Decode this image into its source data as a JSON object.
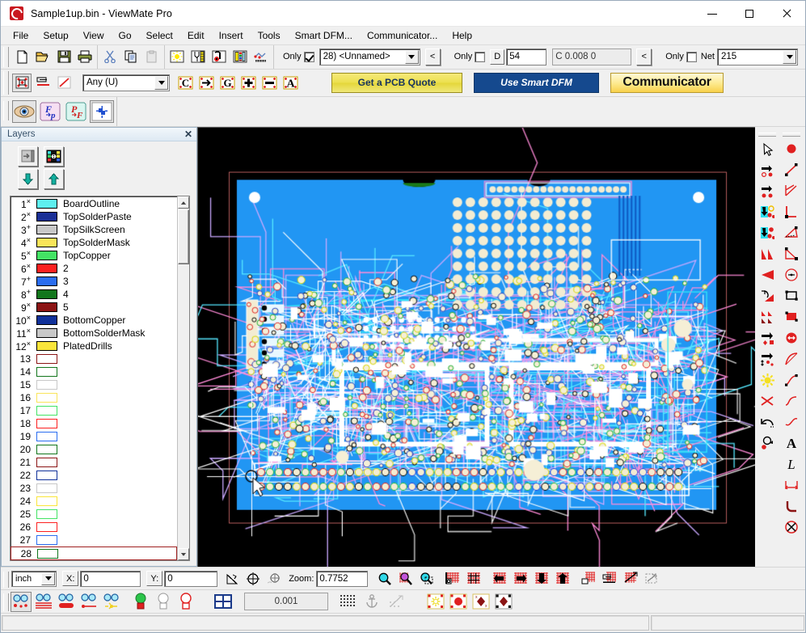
{
  "window": {
    "title": "Sample1up.bin - ViewMate Pro",
    "icon": "viewmate-logo-icon",
    "buttons": {
      "minimize": "minimize",
      "maximize": "maximize",
      "close": "close"
    }
  },
  "menu": {
    "items": [
      {
        "label": "File"
      },
      {
        "label": "Setup"
      },
      {
        "label": "View"
      },
      {
        "label": "Go"
      },
      {
        "label": "Select"
      },
      {
        "label": "Edit"
      },
      {
        "label": "Insert"
      },
      {
        "label": "Tools"
      },
      {
        "label": "Smart DFM..."
      },
      {
        "label": "Communicator..."
      },
      {
        "label": "Help"
      }
    ]
  },
  "toolbar_file": {
    "icons": [
      "new-document-icon",
      "open-folder-icon",
      "save-disk-icon",
      "print-icon"
    ]
  },
  "toolbar_clipboard": {
    "icons": [
      "cut-scissors-icon",
      "copy-icon",
      "paste-icon"
    ]
  },
  "toolbar_display": {
    "icons": [
      "flash-display-icon",
      "aperture-icon",
      "drill-icon",
      "layers-color-icon",
      "trace-icon"
    ]
  },
  "layer_selector": {
    "only_label": "Only",
    "only_checked": true,
    "value": "28) <Unnamed>",
    "prev_button": "<"
  },
  "dcode_selector": {
    "only_label": "Only",
    "only_checked": false,
    "d_label": "D",
    "d_value": "54",
    "c_value": "C 0.008  0",
    "prev_button": "<"
  },
  "net_selector": {
    "only_label": "Only",
    "only_checked": false,
    "net_label": "Net",
    "value": "215"
  },
  "toolbar_edit2": {
    "icons": [
      "select-pads-icon",
      "select-traces-icon",
      "draw-line-icon"
    ],
    "type_combo_value": "Any   (U)",
    "letter_icons": [
      "copper-c-icon",
      "goto-arrow-icon",
      "graphic-g-icon",
      "plus-pad-icon",
      "minus-pad-icon",
      "text-a-icon"
    ]
  },
  "toolbar_view2": {
    "icons": [
      "eye-visibility-icon",
      "flash-to-pad-icon",
      "pad-to-flash-icon",
      "add-net-icon"
    ]
  },
  "promo": {
    "quote_label": "Get a PCB Quote",
    "dfm_label": "Use Smart DFM",
    "communicator_label": "Communicator"
  },
  "layers_panel": {
    "title": "Layers",
    "close_icon": "close-icon",
    "tools": [
      "align-layers-icon",
      "layer-colors-icon",
      "move-down-icon",
      "move-up-icon"
    ],
    "rows": [
      {
        "num": "1",
        "sup": "×",
        "color": "#5ef0f0",
        "name": "BoardOutline",
        "filled": true
      },
      {
        "num": "2",
        "sup": "×",
        "color": "#1a2f96",
        "name": "TopSolderPaste",
        "filled": true
      },
      {
        "num": "3",
        "sup": "+",
        "color": "#c8c8c8",
        "name": "TopSilkScreen",
        "filled": true
      },
      {
        "num": "4",
        "sup": "×",
        "color": "#fae55a",
        "name": "TopSolderMask",
        "filled": true
      },
      {
        "num": "5",
        "sup": "×",
        "color": "#43e364",
        "name": "TopCopper",
        "filled": true
      },
      {
        "num": "6",
        "sup": "×",
        "color": "#fc2020",
        "name": "2",
        "filled": true
      },
      {
        "num": "7",
        "sup": "+",
        "color": "#2a6df0",
        "name": "3",
        "filled": true
      },
      {
        "num": "8",
        "sup": "+",
        "color": "#12761c",
        "name": "4",
        "filled": true
      },
      {
        "num": "9",
        "sup": "×",
        "color": "#8b1414",
        "name": "5",
        "filled": true
      },
      {
        "num": "10",
        "sup": "×",
        "color": "#10319a",
        "name": "BottomCopper",
        "filled": true
      },
      {
        "num": "11",
        "sup": "×",
        "color": "#c8c8c8",
        "name": "BottomSolderMask",
        "filled": true
      },
      {
        "num": "12",
        "sup": "×",
        "color": "#fae53a",
        "name": "PlatedDrills",
        "filled": true
      },
      {
        "num": "13",
        "sup": "",
        "color": "#8b1414",
        "name": "",
        "filled": false
      },
      {
        "num": "14",
        "sup": "",
        "color": "#12761c",
        "name": "",
        "filled": false
      },
      {
        "num": "15",
        "sup": "",
        "color": "#c8c8c8",
        "name": "",
        "filled": false
      },
      {
        "num": "16",
        "sup": "",
        "color": "#fae55a",
        "name": "",
        "filled": false
      },
      {
        "num": "17",
        "sup": "",
        "color": "#43e364",
        "name": "",
        "filled": false
      },
      {
        "num": "18",
        "sup": "",
        "color": "#fc2020",
        "name": "",
        "filled": false
      },
      {
        "num": "19",
        "sup": "",
        "color": "#2a6df0",
        "name": "",
        "filled": false
      },
      {
        "num": "20",
        "sup": "",
        "color": "#12761c",
        "name": "",
        "filled": false
      },
      {
        "num": "21",
        "sup": "",
        "color": "#8b1414",
        "name": "",
        "filled": false
      },
      {
        "num": "22",
        "sup": "",
        "color": "#10319a",
        "name": "",
        "filled": false
      },
      {
        "num": "23",
        "sup": "",
        "color": "#c8c8c8",
        "name": "",
        "filled": false
      },
      {
        "num": "24",
        "sup": "",
        "color": "#fae53a",
        "name": "",
        "filled": false
      },
      {
        "num": "25",
        "sup": "",
        "color": "#43e364",
        "name": "",
        "filled": false
      },
      {
        "num": "26",
        "sup": "",
        "color": "#fc2020",
        "name": "",
        "filled": false
      },
      {
        "num": "27",
        "sup": "",
        "color": "#2a6df0",
        "name": "",
        "filled": false
      },
      {
        "num": "28",
        "sup": "",
        "color": "#12761c",
        "name": "",
        "filled": false,
        "selected": true
      }
    ]
  },
  "right_toolbar": {
    "column_a": [
      "pointer-select-icon",
      "move-to-pad-icon",
      "copy-pad-icon",
      "import-down-icon",
      "import-down-2-icon",
      "mirror-shape-icon",
      "flip-shape-icon",
      "rotate-shape-icon",
      "scale-shape-icon",
      "move-pad-icon",
      "step-repeat-icon",
      "sun-flash-icon",
      "cut-trace-icon",
      "undo-arc-icon",
      "rotate-pad-icon"
    ],
    "column_b": [
      "flash-round-icon",
      "draw-line-icon",
      "draw-polyline-icon",
      "draw-corner-icon",
      "draw-triangle-icon",
      "draw-tri2-icon",
      "draw-circle-icon",
      "draw-rect-outline-icon",
      "draw-rect-filled-icon",
      "draw-obround-icon",
      "draw-arc-icon",
      "draw-curve-icon",
      "draw-curve2-icon",
      "draw-curve3-icon",
      "text-a-icon",
      "text-l-icon",
      "dimension-icon",
      "fillet-icon",
      "delete-circle-icon"
    ]
  },
  "status_bottom": {
    "units": "inch",
    "x_label": "X:",
    "x_value": "0",
    "y_label": "Y:",
    "y_value": "0",
    "measure_icons": [
      "measure-angle-icon",
      "target-center-icon",
      "snap-target-icon"
    ],
    "zoom_label": "Zoom:",
    "zoom_value": "0.7752",
    "zoom_icons": [
      "zoom-in-icon",
      "zoom-out-icon",
      "zoom-window-icon"
    ],
    "view_icons": [
      "fit-board-icon",
      "grid-view-icon",
      "pan-left-icon",
      "pan-right-icon",
      "pan-down-icon",
      "pan-up-icon",
      "zoom-area-icon",
      "prev-view-icon",
      "redraw-icon",
      "zoom-select-icon"
    ]
  },
  "status_bottom2": {
    "view_icons": [
      "glasses-dots-icon",
      "glasses-lines-icon",
      "glasses-pads-icon",
      "glasses-trace-icon",
      "glasses-flash-icon"
    ],
    "light_icons": [
      "light-green-icon",
      "light-off-icon",
      "light-red-icon"
    ],
    "grid_icon": "grid-table-icon",
    "grid_value": "0.001",
    "snap_icons": [
      "snap-grid-icon",
      "anchor-icon",
      "snap-line-icon"
    ],
    "flash_icons": [
      "flash-star-icon",
      "flash-round-icon",
      "flash-diamond-icon",
      "flash-solid-icon"
    ]
  },
  "statusbar": {
    "left_text": "",
    "right_text": ""
  },
  "canvas": {
    "background": "#000000",
    "board_fill": "#2196f3",
    "outline_color": "#b05a5a"
  }
}
